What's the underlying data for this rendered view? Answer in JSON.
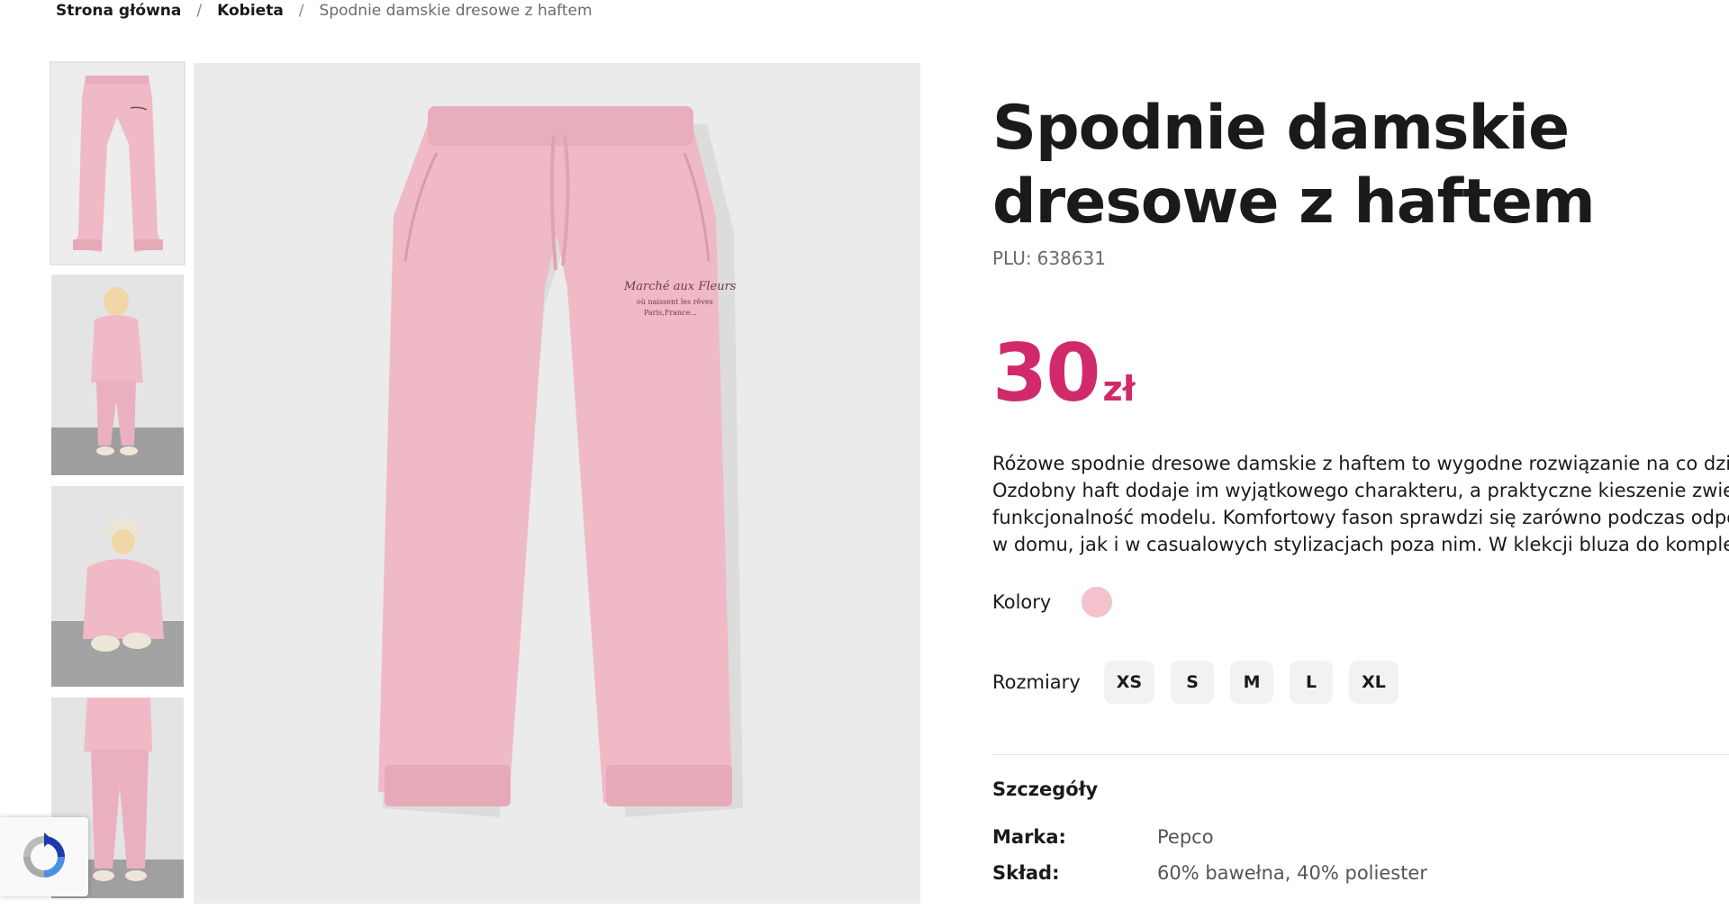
{
  "breadcrumb": {
    "home": "Strona główna",
    "category": "Kobieta",
    "current": "Spodnie damskie dresowe z haftem",
    "separator": "/"
  },
  "gallery": {
    "thumbnails": [
      "pants-flat",
      "model-standing",
      "model-sitting",
      "model-closeup"
    ],
    "main_image": "pink-sweatpants",
    "embroidery_lines": [
      "Marché aux Fleurs",
      "où naissent les rêves",
      "Paris,France..."
    ]
  },
  "product": {
    "title_line1": "Spodnie damskie",
    "title_line2": "dresowe z haftem",
    "plu_label": "PLU:",
    "plu_value": "638631",
    "price_amount": "30",
    "price_currency": "zł",
    "description": [
      "Różowe spodnie dresowe damskie z haftem to wygodne rozwiązanie na co dzień.",
      "Ozdobny haft dodaje im wyjątkowego charakteru, a praktyczne kieszenie zwiększają",
      "funkcjonalność modelu. Komfortowy fason sprawdzi się zarówno podczas odpoczynku",
      "w domu, jak i w casualowych stylizacjach poza nim. W klekcji bluza do kompletu."
    ],
    "colors_label": "Kolory",
    "color_swatch": "#f4c3cd",
    "sizes_label": "Rozmiary",
    "sizes": [
      "XS",
      "S",
      "M",
      "L",
      "XL"
    ]
  },
  "details": {
    "title": "Szczegóły",
    "brand_label": "Marka:",
    "brand_value": "Pepco",
    "composition_label": "Skład:",
    "composition_value": "60% bawełna, 40% poliester"
  },
  "colors": {
    "price": "#d12a6a",
    "pants": "#f0b9c6",
    "background": "#ebebeb"
  },
  "recaptcha": {
    "icon": "recaptcha-icon"
  }
}
